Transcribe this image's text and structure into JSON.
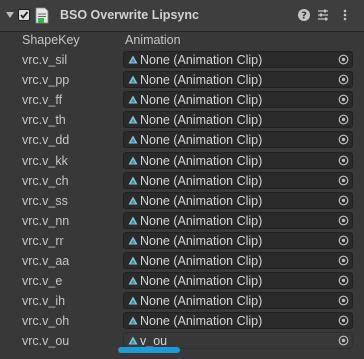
{
  "header": {
    "title": "BSO Overwrite Lipsync",
    "icons": [
      "foldout-arrow-icon",
      "enable-checkbox-icon",
      "script-icon",
      "help-icon",
      "presets-icon",
      "more-options-icon"
    ]
  },
  "columns": {
    "shape_key": "ShapeKey",
    "animation": "Animation"
  },
  "rows": [
    {
      "key": "vrc.v_sil",
      "value": "None (Animation Clip)"
    },
    {
      "key": "vrc.v_pp",
      "value": "None (Animation Clip)"
    },
    {
      "key": "vrc.v_ff",
      "value": "None (Animation Clip)"
    },
    {
      "key": "vrc.v_th",
      "value": "None (Animation Clip)"
    },
    {
      "key": "vrc.v_dd",
      "value": "None (Animation Clip)"
    },
    {
      "key": "vrc.v_kk",
      "value": "None (Animation Clip)"
    },
    {
      "key": "vrc.v_ch",
      "value": "None (Animation Clip)"
    },
    {
      "key": "vrc.v_ss",
      "value": "None (Animation Clip)"
    },
    {
      "key": "vrc.v_nn",
      "value": "None (Animation Clip)"
    },
    {
      "key": "vrc.v_rr",
      "value": "None (Animation Clip)"
    },
    {
      "key": "vrc.v_aa",
      "value": "None (Animation Clip)"
    },
    {
      "key": "vrc.v_e",
      "value": "None (Animation Clip)"
    },
    {
      "key": "vrc.v_ih",
      "value": "None (Animation Clip)"
    },
    {
      "key": "vrc.v_oh",
      "value": "None (Animation Clip)"
    },
    {
      "key": "vrc.v_ou",
      "value": "v_ou"
    }
  ],
  "colors": {
    "background": "#383838",
    "header": "#3e3e3e",
    "field": "#2a2a2a",
    "clip_icon": "#7fc6d6",
    "scroll_thumb": "#1c9bd6"
  }
}
